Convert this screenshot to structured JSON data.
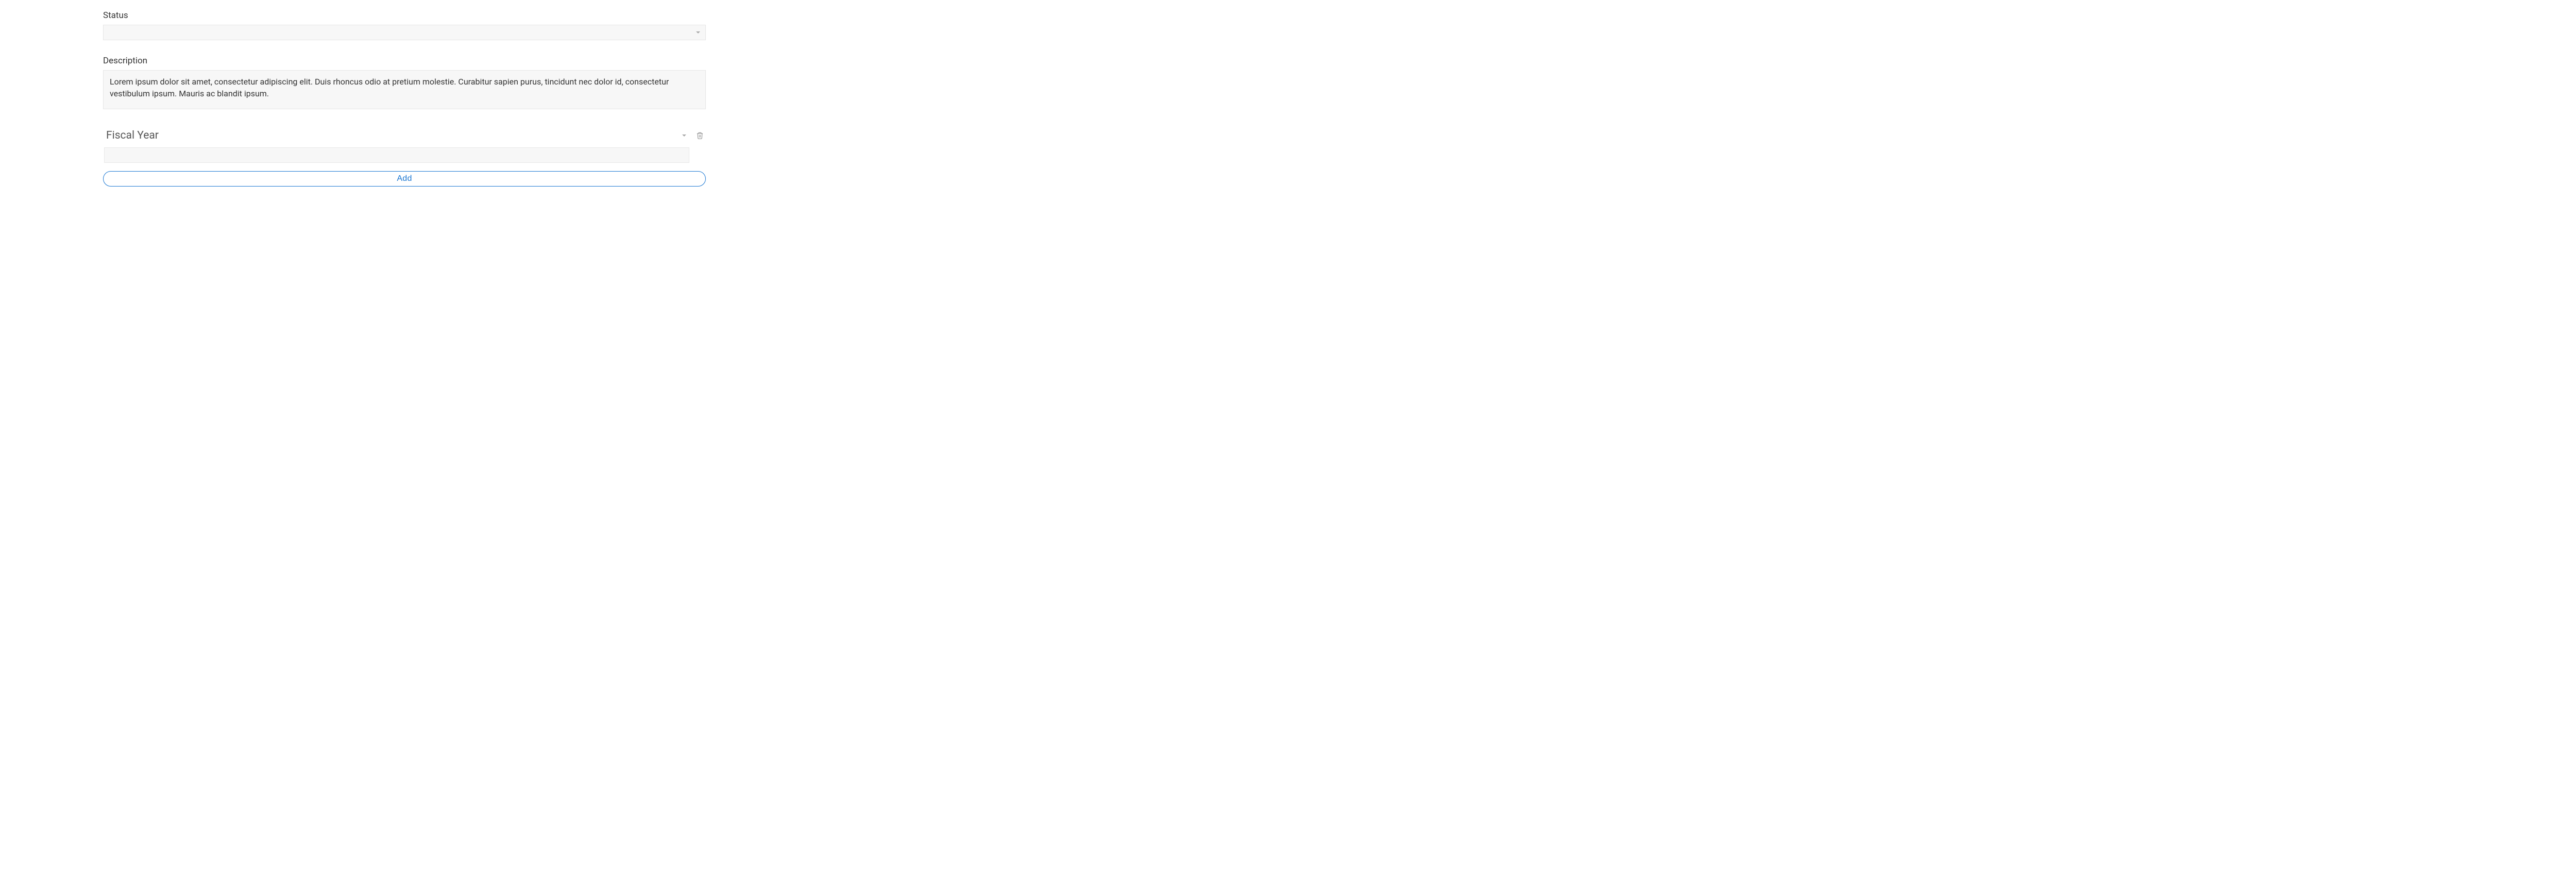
{
  "form": {
    "status": {
      "label": "Status",
      "value": ""
    },
    "description": {
      "label": "Description",
      "value": "Lorem ipsum dolor sit amet, consectetur adipiscing elit. Duis rhoncus odio at pretium molestie. Curabitur sapien purus, tincidunt nec dolor id, consectetur vestibulum ipsum. Mauris ac blandit ipsum."
    },
    "fiscal": {
      "selected_label": "Fiscal Year",
      "input_value": ""
    },
    "add_button_label": "Add"
  }
}
